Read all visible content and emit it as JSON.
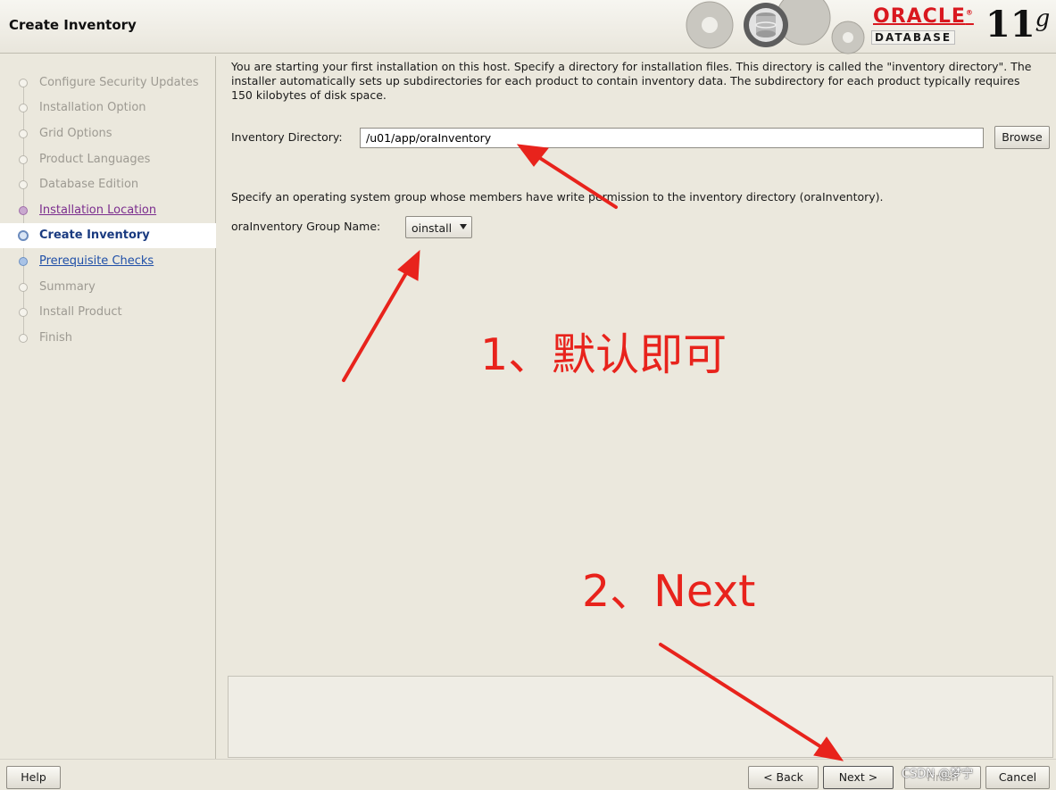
{
  "window": {
    "title": "Create Inventory",
    "brand": "ORACLE",
    "brand_registered": "®",
    "product": "DATABASE",
    "version_number": "11",
    "version_letter": "g"
  },
  "nav": {
    "items": [
      {
        "label": "Configure Security Updates",
        "state": "disabled"
      },
      {
        "label": "Installation Option",
        "state": "disabled"
      },
      {
        "label": "Grid Options",
        "state": "disabled"
      },
      {
        "label": "Product Languages",
        "state": "disabled"
      },
      {
        "label": "Database Edition",
        "state": "disabled"
      },
      {
        "label": "Installation Location",
        "state": "visited"
      },
      {
        "label": "Create Inventory",
        "state": "current"
      },
      {
        "label": "Prerequisite Checks",
        "state": "next"
      },
      {
        "label": "Summary",
        "state": "disabled"
      },
      {
        "label": "Install Product",
        "state": "disabled"
      },
      {
        "label": "Finish",
        "state": "disabled"
      }
    ]
  },
  "main": {
    "intro": "You are starting your first installation on this host. Specify a directory for installation files. This directory is called the \"inventory directory\". The installer automatically sets up subdirectories for each product to contain inventory data. The subdirectory for each product typically requires 150 kilobytes of disk space.",
    "inventory_label": "Inventory Directory:",
    "inventory_value": "/u01/app/oraInventory",
    "browse_label": "Browse",
    "group_desc": "Specify an operating system group whose members have write permission to the inventory directory (oraInventory).",
    "group_label": "oraInventory Group Name:",
    "group_value": "oinstall"
  },
  "buttons": {
    "help": "Help",
    "back": "< Back",
    "next": "Next >",
    "finish": "Finish",
    "cancel": "Cancel"
  },
  "annotations": {
    "note1": "1、默认即可",
    "note2": "2、Next",
    "color": "#e8231c"
  },
  "watermark": "CSDN @梦宁"
}
